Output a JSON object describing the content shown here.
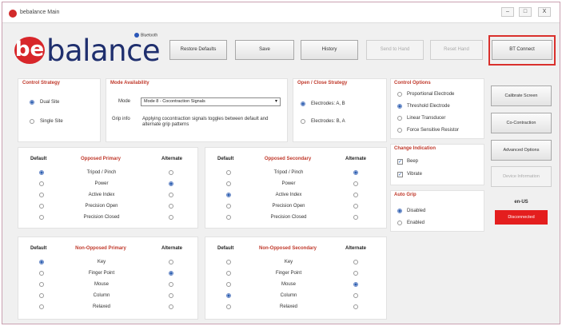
{
  "window": {
    "title": "bebalance Main",
    "controls": [
      "–",
      "□",
      "X"
    ]
  },
  "logo": {
    "be": "be",
    "text": "balance",
    "badge": "Bluetooth"
  },
  "toolbar": {
    "restore_defaults": "Restore Defaults",
    "save": "Save",
    "history": "History",
    "send_to_hand": "Send to Hand",
    "reset_hand": "Reset Hand",
    "bt_connect": "BT Connect"
  },
  "control_strategy": {
    "title": "Control Strategy",
    "options": [
      "Dual Site",
      "Single Site"
    ],
    "selected": "Dual Site"
  },
  "mode_availability": {
    "title": "Mode Availability",
    "mode_label": "Mode",
    "mode_value": "Mode 8 - Cocontraction Signals",
    "info_label": "Grip info",
    "info_text": "Applying cocontraction signals toggles between default and alternate grip patterns"
  },
  "open_close_strategy": {
    "title": "Open / Close Strategy",
    "options": [
      "Electrodes: A, B",
      "Electrodes: B, A"
    ],
    "selected": "Electrodes: A, B"
  },
  "control_options": {
    "title": "Control Options",
    "options": [
      "Proportional Electrode",
      "Threshold Electrode",
      "Linear Transducer",
      "Force Sensitive Resistor"
    ],
    "selected": "Threshold Electrode"
  },
  "change_indication": {
    "title": "Change Indication",
    "options": [
      "Beep",
      "Vibrate"
    ],
    "checked": [
      true,
      true
    ]
  },
  "auto_grip": {
    "title": "Auto Grip",
    "options": [
      "Disabled",
      "Enabled"
    ],
    "selected": "Disabled"
  },
  "sidebar": {
    "calibrate_screen": "Calibrate Screen",
    "co_contraction": "Co-Contraction",
    "advanced_options": "Advanced Options",
    "device_information": "Device Information",
    "device_id": "en-US",
    "status": "Disconnected"
  },
  "opposed_primary": {
    "default_header": "Default",
    "title": "Opposed Primary",
    "alternate_header": "Alternate",
    "rows": [
      "Tripod / Pinch",
      "Power",
      "Active Index",
      "Precision Open",
      "Precision Closed"
    ],
    "default_selected": 0,
    "alternate_selected": 1
  },
  "opposed_secondary": {
    "default_header": "Default",
    "title": "Opposed Secondary",
    "alternate_header": "Alternate",
    "rows": [
      "Tripod / Pinch",
      "Power",
      "Active Index",
      "Precision Open",
      "Precision Closed"
    ],
    "default_selected": 2,
    "alternate_selected": 0
  },
  "non_opposed_primary": {
    "default_header": "Default",
    "title": "Non-Opposed Primary",
    "alternate_header": "Alternate",
    "rows": [
      "Key",
      "Finger Point",
      "Mouse",
      "Column",
      "Relaxed"
    ],
    "default_selected": 0,
    "alternate_selected": 1
  },
  "non_opposed_secondary": {
    "default_header": "Default",
    "title": "Non-Opposed Secondary",
    "alternate_header": "Alternate",
    "rows": [
      "Key",
      "Finger Point",
      "Mouse",
      "Column",
      "Relaxed"
    ],
    "default_selected": 3,
    "alternate_selected": 2
  }
}
